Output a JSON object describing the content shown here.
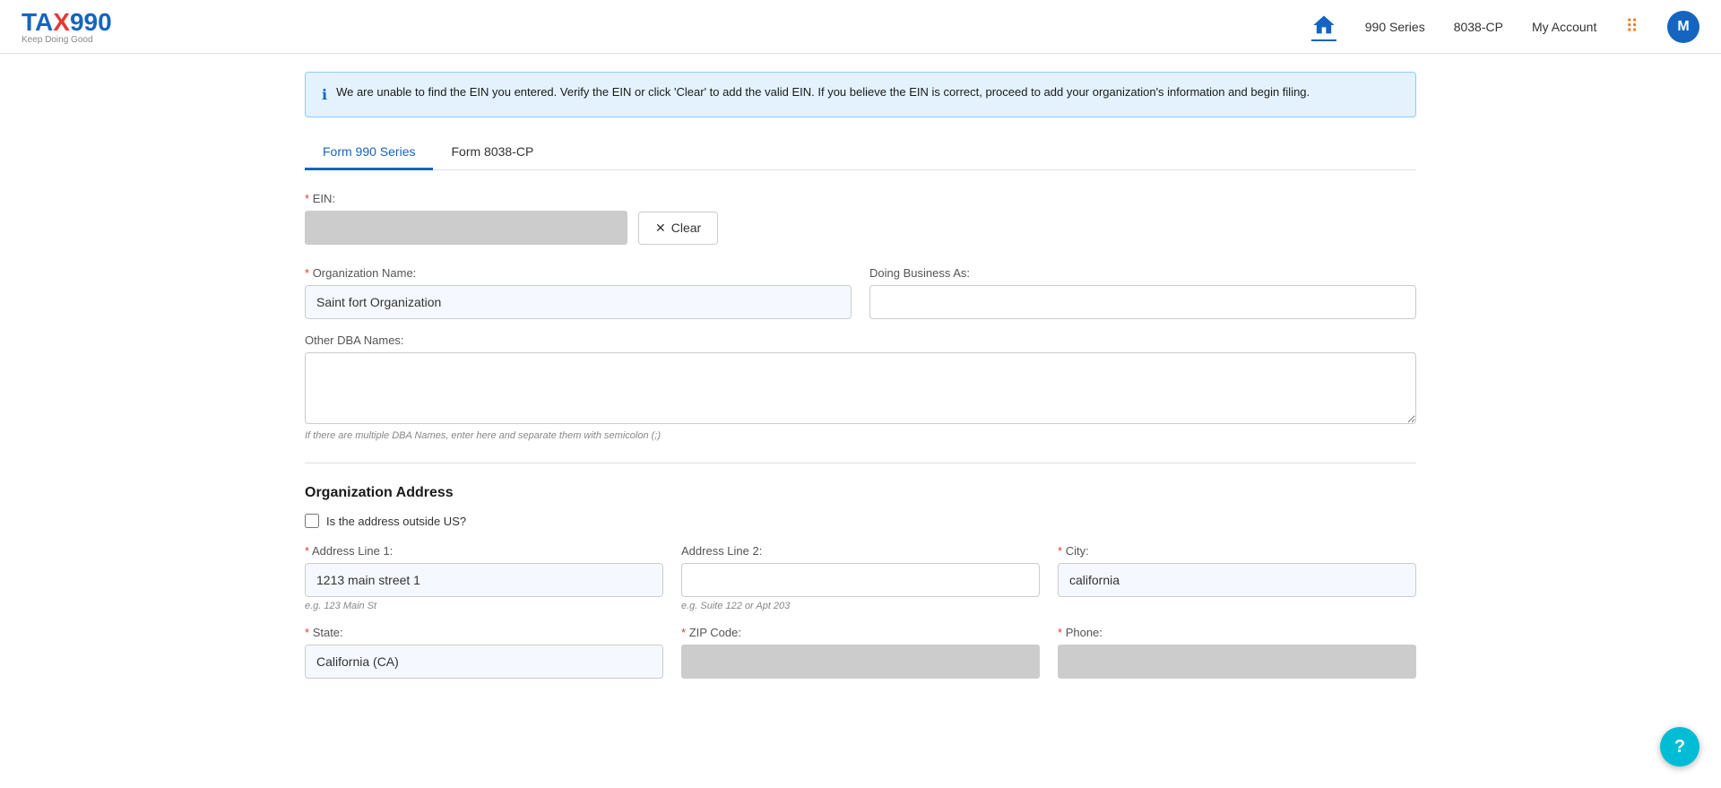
{
  "header": {
    "logo_tax": "TAX",
    "logo_x": "",
    "logo_990": "990",
    "logo_subtitle": "Keep Doing Good",
    "nav_990_series": "990 Series",
    "nav_8038cp": "8038-CP",
    "nav_my_account": "My Account",
    "avatar_letter": "M"
  },
  "info_banner": {
    "message": "We are unable to find the EIN you entered. Verify the EIN or click 'Clear' to add the valid EIN. If you believe the EIN is correct, proceed to add your organization's information and begin filing."
  },
  "tabs": [
    {
      "label": "Form 990 Series",
      "active": true
    },
    {
      "label": "Form 8038-CP",
      "active": false
    }
  ],
  "form": {
    "ein_label": "EIN:",
    "ein_required": "*",
    "ein_value": "••••••••",
    "clear_button": "Clear",
    "org_name_label": "Organization Name:",
    "org_name_required": "*",
    "org_name_value": "Saint fort Organization",
    "dba_label": "Doing Business As:",
    "dba_value": "",
    "other_dba_label": "Other DBA Names:",
    "other_dba_placeholder": "",
    "other_dba_hint": "If there are multiple DBA Names, enter here and separate them with semicolon (;)",
    "address_section_title": "Organization Address",
    "outside_us_label": "Is the address outside US?",
    "address1_label": "Address Line 1:",
    "address1_required": "*",
    "address1_value": "1213 main street 1",
    "address1_hint": "e.g. 123 Main St",
    "address2_label": "Address Line 2:",
    "address2_value": "",
    "address2_hint": "e.g. Suite 122 or Apt 203",
    "city_label": "City:",
    "city_required": "*",
    "city_value": "california",
    "state_label": "State:",
    "state_required": "*",
    "state_value": "California (CA)",
    "zip_label": "ZIP Code:",
    "zip_required": "*",
    "zip_value": "",
    "phone_label": "Phone:",
    "phone_required": "*",
    "phone_value": ""
  }
}
